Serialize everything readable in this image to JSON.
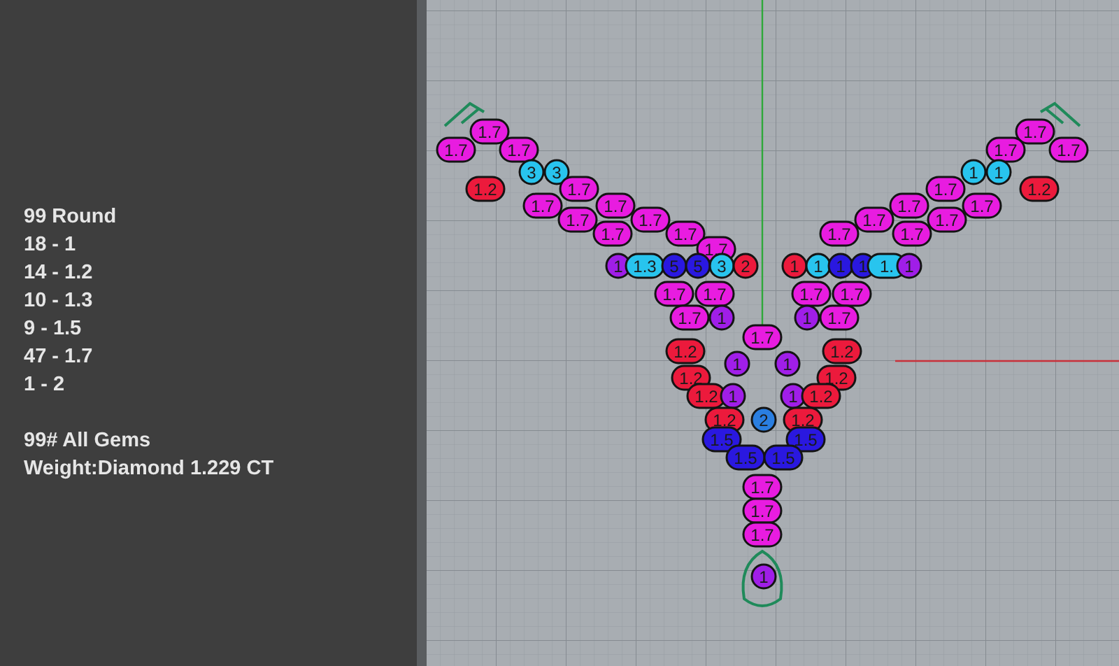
{
  "info_panel": {
    "summary": [
      "99 Round",
      "18 - 1",
      "14 - 1.2",
      "10 - 1.3",
      "9 - 1.5",
      "47 - 1.7",
      "1 - 2"
    ],
    "totals": [
      "99# All Gems",
      "Weight:Diamond 1.229 CT"
    ]
  },
  "gems": [
    {
      "label": "1.7",
      "color": "#e81ce0"
    },
    {
      "label": "1.7",
      "color": "#e81ce0"
    },
    {
      "label": "1.7",
      "color": "#e81ce0"
    },
    {
      "label": "1.7",
      "color": "#e81ce0"
    },
    {
      "label": "1.7",
      "color": "#e81ce0"
    },
    {
      "label": "1.7",
      "color": "#e81ce0"
    },
    {
      "label": "3",
      "color": "#28c4ee"
    },
    {
      "label": "3",
      "color": "#28c4ee"
    },
    {
      "label": "1",
      "color": "#28c4ee"
    },
    {
      "label": "1",
      "color": "#28c4ee"
    },
    {
      "label": "1.2",
      "color": "#ec1a3c"
    },
    {
      "label": "1.7",
      "color": "#e81ce0"
    },
    {
      "label": "1.7",
      "color": "#e81ce0"
    },
    {
      "label": "1.2",
      "color": "#ec1a3c"
    },
    {
      "label": "1.7",
      "color": "#e81ce0"
    },
    {
      "label": "1.7",
      "color": "#e81ce0"
    },
    {
      "label": "1.7",
      "color": "#e81ce0"
    },
    {
      "label": "1.7",
      "color": "#e81ce0"
    },
    {
      "label": "1.7",
      "color": "#e81ce0"
    },
    {
      "label": "1.7",
      "color": "#e81ce0"
    },
    {
      "label": "1.7",
      "color": "#e81ce0"
    },
    {
      "label": "1.7",
      "color": "#e81ce0"
    },
    {
      "label": "1.7",
      "color": "#e81ce0"
    },
    {
      "label": "1.7",
      "color": "#e81ce0"
    },
    {
      "label": "1.7",
      "color": "#e81ce0"
    },
    {
      "label": "1.7",
      "color": "#e81ce0"
    },
    {
      "label": "1.7",
      "color": "#e81ce0"
    },
    {
      "label": "1",
      "color": "#a01ee8"
    },
    {
      "label": "1.3",
      "color": "#28c4ee"
    },
    {
      "label": "5",
      "color": "#2a18e0"
    },
    {
      "label": "5",
      "color": "#2a18e0"
    },
    {
      "label": "3",
      "color": "#28c4ee"
    },
    {
      "label": "2",
      "color": "#ec1a3c"
    },
    {
      "label": "1",
      "color": "#ec1a3c"
    },
    {
      "label": "1",
      "color": "#28c4ee"
    },
    {
      "label": "1",
      "color": "#2a18e0"
    },
    {
      "label": "1",
      "color": "#2a18e0"
    },
    {
      "label": "1.",
      "color": "#28c4ee"
    },
    {
      "label": "1",
      "color": "#a01ee8"
    },
    {
      "label": "1.7",
      "color": "#e81ce0"
    },
    {
      "label": "1.7",
      "color": "#e81ce0"
    },
    {
      "label": "1.7",
      "color": "#e81ce0"
    },
    {
      "label": "1.7",
      "color": "#e81ce0"
    },
    {
      "label": "1.7",
      "color": "#e81ce0"
    },
    {
      "label": "1",
      "color": "#a01ee8"
    },
    {
      "label": "1",
      "color": "#a01ee8"
    },
    {
      "label": "1.7",
      "color": "#e81ce0"
    },
    {
      "label": "1.7",
      "color": "#e81ce0"
    },
    {
      "label": "1.2",
      "color": "#ec1a3c"
    },
    {
      "label": "1.2",
      "color": "#ec1a3c"
    },
    {
      "label": "1",
      "color": "#a01ee8"
    },
    {
      "label": "1",
      "color": "#a01ee8"
    },
    {
      "label": "1.2",
      "color": "#ec1a3c"
    },
    {
      "label": "1.2",
      "color": "#ec1a3c"
    },
    {
      "label": "1.2",
      "color": "#ec1a3c"
    },
    {
      "label": "1",
      "color": "#a01ee8"
    },
    {
      "label": "1",
      "color": "#a01ee8"
    },
    {
      "label": "1.2",
      "color": "#ec1a3c"
    },
    {
      "label": "1.2",
      "color": "#ec1a3c"
    },
    {
      "label": "2",
      "color": "#2a7ee0"
    },
    {
      "label": "1.2",
      "color": "#ec1a3c"
    },
    {
      "label": "1.5",
      "color": "#2a18e0"
    },
    {
      "label": "1.5",
      "color": "#2a18e0"
    },
    {
      "label": "1.5",
      "color": "#2a18e0"
    },
    {
      "label": "1.5",
      "color": "#2a18e0"
    },
    {
      "label": "1.7",
      "color": "#e81ce0"
    },
    {
      "label": "1.7",
      "color": "#e81ce0"
    },
    {
      "label": "1.7",
      "color": "#e81ce0"
    },
    {
      "label": "1",
      "color": "#a01ee8"
    }
  ]
}
